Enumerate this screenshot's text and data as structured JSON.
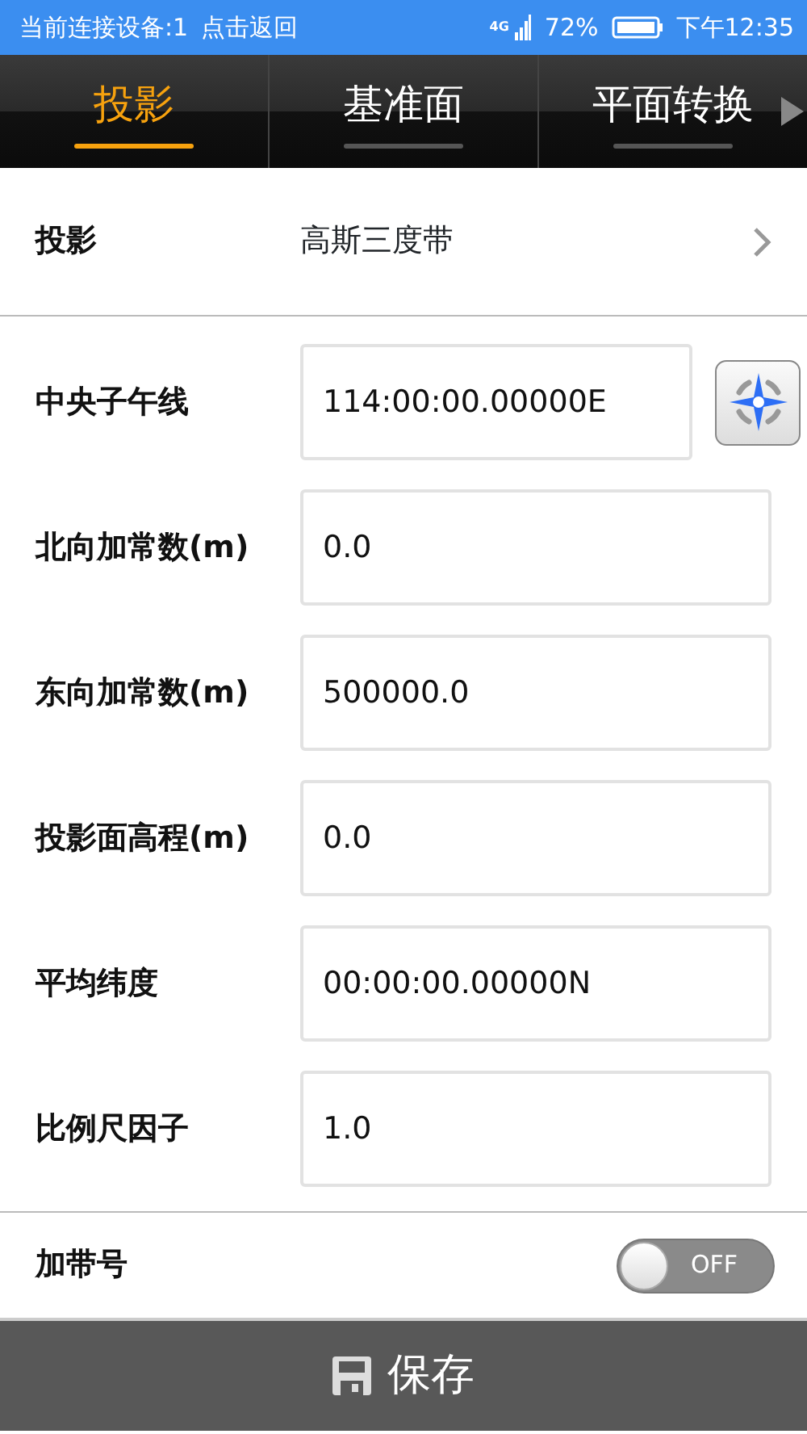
{
  "status_bar": {
    "connection": "当前连接设备:1",
    "back": "点击返回",
    "network": "4G",
    "battery": "72%",
    "time": "下午12:35"
  },
  "tabs": [
    {
      "label": "投影",
      "selected": true
    },
    {
      "label": "基准面",
      "selected": false
    },
    {
      "label": "平面转换",
      "selected": false
    }
  ],
  "projection": {
    "label": "投影",
    "value": "高斯三度带"
  },
  "fields": [
    {
      "label": "中央子午线",
      "value": "114:00:00.00000E",
      "kind": "locate"
    },
    {
      "label": "北向加常数(m)",
      "value": "0.0",
      "kind": "plain"
    },
    {
      "label": "东向加常数(m)",
      "value": "500000.0",
      "kind": "plain"
    },
    {
      "label": "投影面高程(m)",
      "value": "0.0",
      "kind": "plain"
    },
    {
      "label": "平均纬度",
      "value": "00:00:00.00000N",
      "kind": "plain"
    },
    {
      "label": "比例尺因子",
      "value": "1.0",
      "kind": "plain"
    }
  ],
  "zone_number": {
    "label": "加带号",
    "on": false,
    "state_text": "OFF"
  },
  "save_button": {
    "label": "保存"
  }
}
